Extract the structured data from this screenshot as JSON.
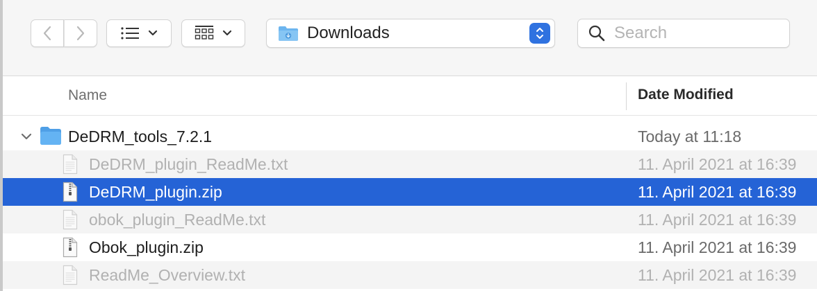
{
  "toolbar": {
    "location": "Downloads",
    "search_placeholder": "Search"
  },
  "columns": {
    "name": "Name",
    "date_modified": "Date Modified"
  },
  "rows": [
    {
      "name": "DeDRM_tools_7.2.1",
      "date": "Today at 11:18",
      "kind": "folder",
      "state": "normal"
    },
    {
      "name": "DeDRM_plugin_ReadMe.txt",
      "date": "11. April 2021 at 16:39",
      "kind": "text",
      "state": "dim"
    },
    {
      "name": "DeDRM_plugin.zip",
      "date": "11. April 2021 at 16:39",
      "kind": "zip",
      "state": "selected"
    },
    {
      "name": "obok_plugin_ReadMe.txt",
      "date": "11. April 2021 at 16:39",
      "kind": "text",
      "state": "dim"
    },
    {
      "name": "Obok_plugin.zip",
      "date": "11. April 2021 at 16:39",
      "kind": "zip",
      "state": "normal"
    },
    {
      "name": "ReadMe_Overview.txt",
      "date": "11. April 2021 at 16:39",
      "kind": "text",
      "state": "dim"
    }
  ],
  "colors": {
    "selection": "#2563d6",
    "folder": "#5aaef0",
    "stepper": "#2f72e0"
  }
}
